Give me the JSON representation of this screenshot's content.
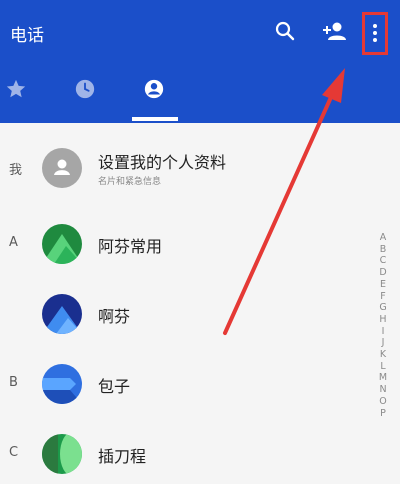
{
  "header": {
    "title": "电话",
    "icons": [
      "search-icon",
      "add-contact-icon",
      "more-vert-icon"
    ],
    "background": "#1b4fc9"
  },
  "tabs": [
    {
      "icon": "star-icon",
      "name": "favorites"
    },
    {
      "icon": "clock-icon",
      "name": "recents"
    },
    {
      "icon": "contacts-icon",
      "name": "contacts",
      "selected": true
    }
  ],
  "profile": {
    "section": "我",
    "label": "设置我的个人资料",
    "sublabel": "名片和紧急信息"
  },
  "contacts": [
    {
      "section": "A",
      "name": "阿芬常用"
    },
    {
      "section": "",
      "name": "啊芬"
    },
    {
      "section": "B",
      "name": "包子"
    },
    {
      "section": "C",
      "name": "插刀程"
    }
  ],
  "alphabet": [
    "A",
    "B",
    "C",
    "D",
    "E",
    "F",
    "G",
    "H",
    "I",
    "J",
    "K",
    "L",
    "M",
    "N",
    "O",
    "P"
  ],
  "annotation": {
    "color": "#e53935"
  }
}
